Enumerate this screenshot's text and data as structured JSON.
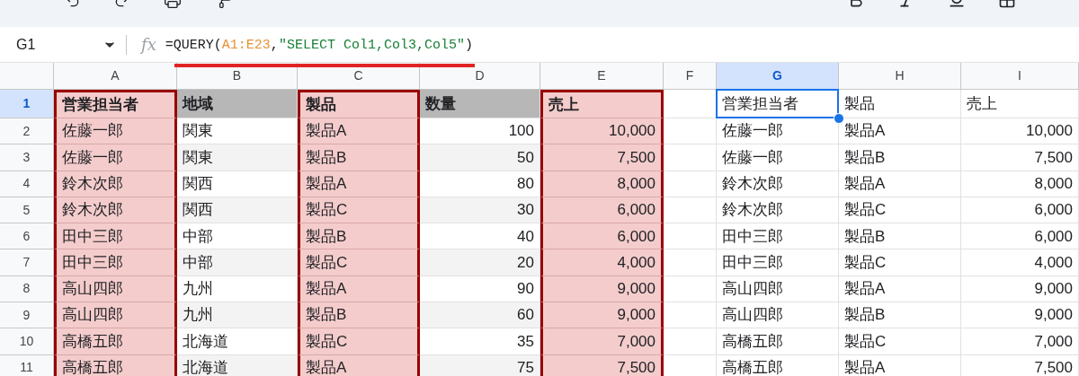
{
  "name_box": "G1",
  "fx_label": "fx",
  "formula": [
    {
      "kind": "plain",
      "text": "=QUERY("
    },
    {
      "kind": "range",
      "text": "A1:E23"
    },
    {
      "kind": "plain",
      "text": ","
    },
    {
      "kind": "string",
      "text": "\"SELECT Col1,Col3,Col5\""
    },
    {
      "kind": "plain",
      "text": ")"
    }
  ],
  "columns": [
    {
      "letter": "A",
      "formatted": true,
      "kind": "text",
      "highlighted": true,
      "selected": false
    },
    {
      "letter": "B",
      "formatted": true,
      "kind": "text",
      "highlighted": false,
      "selected": false
    },
    {
      "letter": "C",
      "formatted": true,
      "kind": "text",
      "highlighted": true,
      "selected": false
    },
    {
      "letter": "D",
      "formatted": true,
      "kind": "number",
      "highlighted": false,
      "selected": false
    },
    {
      "letter": "E",
      "formatted": true,
      "kind": "number",
      "highlighted": true,
      "selected": false
    },
    {
      "letter": "F",
      "formatted": false,
      "kind": "text",
      "highlighted": false,
      "selected": false
    },
    {
      "letter": "G",
      "formatted": false,
      "kind": "text",
      "highlighted": false,
      "selected": true
    },
    {
      "letter": "H",
      "formatted": false,
      "kind": "text",
      "highlighted": false,
      "selected": false
    },
    {
      "letter": "I",
      "formatted": false,
      "kind": "number",
      "highlighted": false,
      "selected": false
    }
  ],
  "rows": [
    {
      "number": "1",
      "kind": "header",
      "selected": true,
      "cells": [
        "営業担当者",
        "地域",
        "製品",
        "数量",
        "売上",
        null,
        "営業担当者",
        "製品",
        "売上"
      ]
    },
    {
      "number": "2",
      "kind": "data",
      "selected": false,
      "cells": [
        "佐藤一郎",
        "関東",
        "製品A",
        "100",
        "10,000",
        null,
        "佐藤一郎",
        "製品A",
        "10,000"
      ]
    },
    {
      "number": "3",
      "kind": "data",
      "selected": false,
      "cells": [
        "佐藤一郎",
        "関東",
        "製品B",
        "50",
        "7,500",
        null,
        "佐藤一郎",
        "製品B",
        "7,500"
      ]
    },
    {
      "number": "4",
      "kind": "data",
      "selected": false,
      "cells": [
        "鈴木次郎",
        "関西",
        "製品A",
        "80",
        "8,000",
        null,
        "鈴木次郎",
        "製品A",
        "8,000"
      ]
    },
    {
      "number": "5",
      "kind": "data",
      "selected": false,
      "cells": [
        "鈴木次郎",
        "関西",
        "製品C",
        "30",
        "6,000",
        null,
        "鈴木次郎",
        "製品C",
        "6,000"
      ]
    },
    {
      "number": "6",
      "kind": "data",
      "selected": false,
      "cells": [
        "田中三郎",
        "中部",
        "製品B",
        "40",
        "6,000",
        null,
        "田中三郎",
        "製品B",
        "6,000"
      ]
    },
    {
      "number": "7",
      "kind": "data",
      "selected": false,
      "cells": [
        "田中三郎",
        "中部",
        "製品C",
        "20",
        "4,000",
        null,
        "田中三郎",
        "製品C",
        "4,000"
      ]
    },
    {
      "number": "8",
      "kind": "data",
      "selected": false,
      "cells": [
        "高山四郎",
        "九州",
        "製品A",
        "90",
        "9,000",
        null,
        "高山四郎",
        "製品A",
        "9,000"
      ]
    },
    {
      "number": "9",
      "kind": "data",
      "selected": false,
      "cells": [
        "高山四郎",
        "九州",
        "製品B",
        "60",
        "9,000",
        null,
        "高山四郎",
        "製品B",
        "9,000"
      ]
    },
    {
      "number": "10",
      "kind": "data",
      "selected": false,
      "cells": [
        "高橋五郎",
        "北海道",
        "製品C",
        "35",
        "7,000",
        null,
        "高橋五郎",
        "製品C",
        "7,000"
      ]
    },
    {
      "number": "11",
      "kind": "data",
      "selected": false,
      "cells": [
        "高橋五郎",
        "北海道",
        "製品A",
        "75",
        "7,500",
        null,
        "高橋五郎",
        "製品A",
        "7,500"
      ]
    }
  ]
}
